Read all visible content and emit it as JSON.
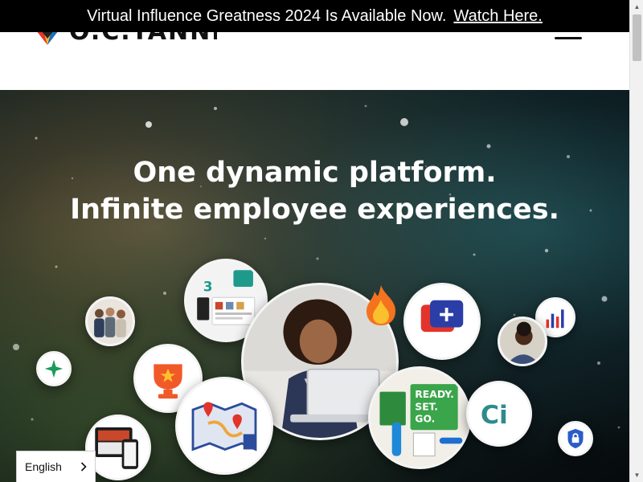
{
  "announcement": {
    "text": "Virtual Influence Greatness 2024 Is Available Now.",
    "link_label": "Watch Here."
  },
  "header": {
    "logo_text": "O.C.TANNER",
    "menu_icon": "hamburger-icon"
  },
  "hero": {
    "headline_line1": "One dynamic platform.",
    "headline_line2": "Infinite employee experiences.",
    "bubbles": [
      {
        "icon": "team-photo"
      },
      {
        "icon": "app-screens"
      },
      {
        "icon": "woman-laptop"
      },
      {
        "icon": "fire-emoji"
      },
      {
        "icon": "chat-plus-icon"
      },
      {
        "icon": "bar-chart-icon"
      },
      {
        "icon": "man-phone-photo"
      },
      {
        "icon": "sparkle-star-icon"
      },
      {
        "icon": "trophy-star-icon"
      },
      {
        "icon": "map-pins-icon"
      },
      {
        "icon": "ready-set-go-kit"
      },
      {
        "icon": "ci-logo"
      },
      {
        "icon": "shield-lock-icon"
      },
      {
        "icon": "devices-photo"
      }
    ],
    "ci_text": "Ci",
    "kit_text": "READY. SET. GO."
  },
  "language": {
    "selected": "English",
    "chevron_icon": "chevron-right-icon"
  },
  "colors": {
    "announce_bg": "#000000",
    "logo_red": "#e63329",
    "logo_yellow": "#f6b51e",
    "logo_blue": "#1c6fb7",
    "chat_red": "#e2342a",
    "trophy_orange": "#f05a28",
    "sparkle_green": "#1a9b58",
    "kit_green": "#3aa54a"
  }
}
